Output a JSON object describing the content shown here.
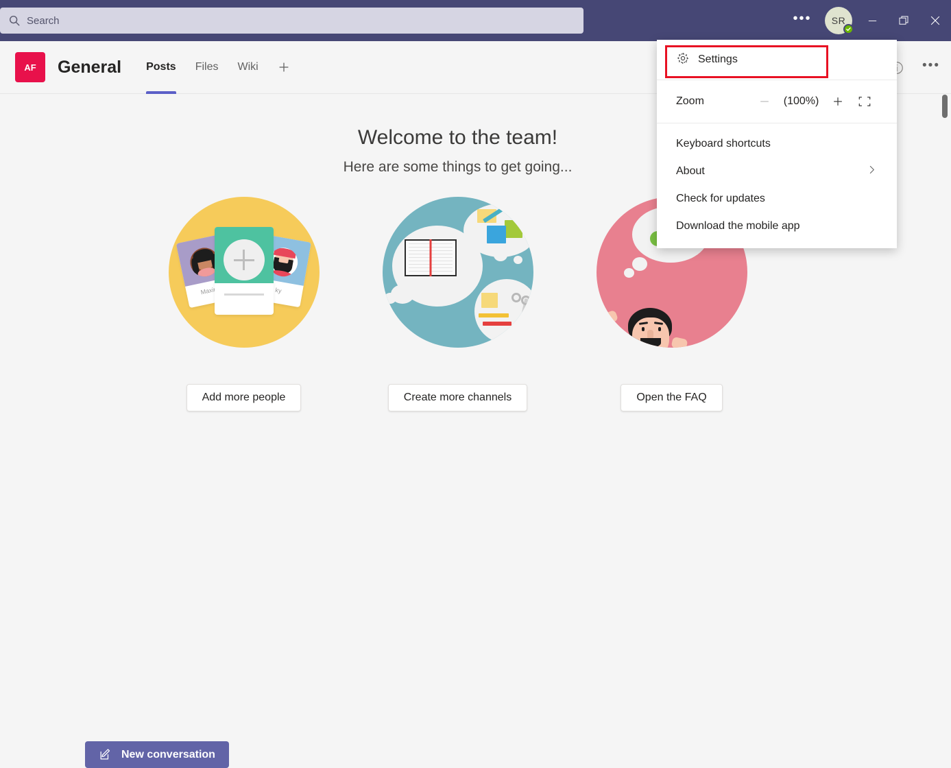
{
  "titlebar": {
    "search": {
      "placeholder": "Search",
      "value": "",
      "icon": "search-icon"
    },
    "more_options_label": "...",
    "avatar": {
      "initials": "SR",
      "status": "available"
    },
    "minimize_label": "Minimize",
    "maximize_label": "Restore",
    "close_label": "Close"
  },
  "channel": {
    "team_initials": "AF",
    "title": "General",
    "tabs": [
      {
        "label": "Posts",
        "active": true
      },
      {
        "label": "Files",
        "active": false
      },
      {
        "label": "Wiki",
        "active": false
      }
    ],
    "add_tab_label": "+",
    "info_icon": "info-icon",
    "more_icon": "more-options-icon"
  },
  "main": {
    "welcome_title": "Welcome to the team!",
    "welcome_subtitle": "Here are some things to get going...",
    "cards": [
      {
        "button_label": "Add more people",
        "circle_color": "#f6cb5a",
        "illustration": "people-photo-cards",
        "person_left_name": "Maxine",
        "person_right_name": "ky"
      },
      {
        "button_label": "Create more channels",
        "circle_color": "#74b4c0",
        "illustration": "notebook-supplies"
      },
      {
        "button_label": "Open the FAQ",
        "circle_color": "#e8808f",
        "illustration": "person-thinking"
      }
    ],
    "new_conversation_label": "New conversation"
  },
  "menu": {
    "settings": {
      "label": "Settings",
      "icon": "gear-icon",
      "highlighted": true,
      "highlight_color": "#e81123"
    },
    "zoom": {
      "label": "Zoom",
      "value": "(100%)",
      "minus_label": "Zoom out",
      "plus_label": "Zoom in",
      "fullscreen_label": "Full screen"
    },
    "items": [
      {
        "label": "Keyboard shortcuts",
        "has_submenu": false
      },
      {
        "label": "About",
        "has_submenu": true
      },
      {
        "label": "Check for updates",
        "has_submenu": false
      },
      {
        "label": "Download the mobile app",
        "has_submenu": false
      }
    ]
  },
  "theme": {
    "header_purple": "#464775",
    "accent_purple": "#6264a7",
    "tab_indicator": "#5b5fc7",
    "team_badge_red": "#e8114b",
    "content_bg": "#f5f5f5",
    "presence_green": "#6bb700"
  }
}
